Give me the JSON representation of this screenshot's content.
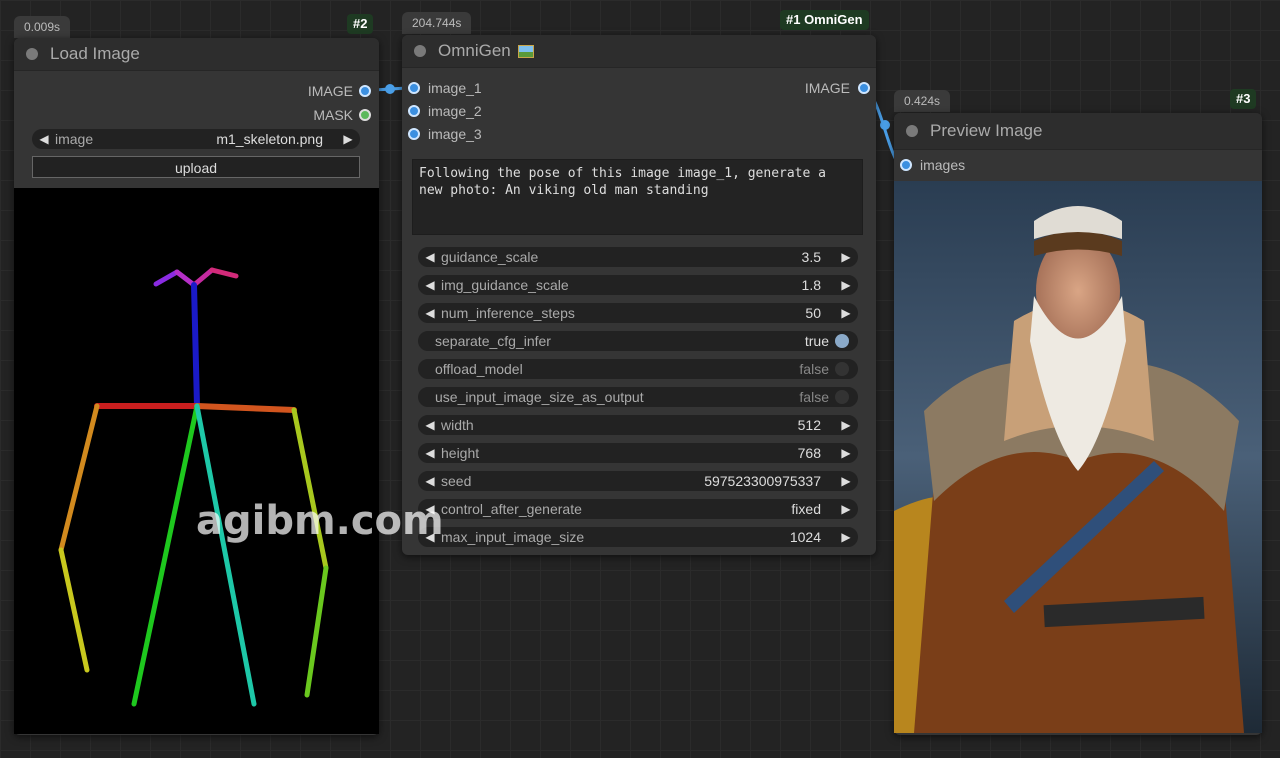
{
  "load_image": {
    "time": "0.009s",
    "id": "#2",
    "title": "Load Image",
    "outputs": [
      "IMAGE",
      "MASK"
    ],
    "image_widget_label": "image",
    "image_widget_value": "m1_skeleton.png",
    "upload_label": "upload"
  },
  "omnigen": {
    "time": "204.744s",
    "id": "#1 OmniGen",
    "title": "OmniGen",
    "title_icon": "picture-icon",
    "inputs": [
      "image_1",
      "image_2",
      "image_3"
    ],
    "output": "IMAGE",
    "prompt": "Following the pose of this image image_1, generate a\nnew photo: An viking old man standing",
    "widgets": [
      {
        "label": "guidance_scale",
        "value": "3.5",
        "type": "number"
      },
      {
        "label": "img_guidance_scale",
        "value": "1.8",
        "type": "number"
      },
      {
        "label": "num_inference_steps",
        "value": "50",
        "type": "number"
      },
      {
        "label": "separate_cfg_infer",
        "value": "true",
        "type": "toggle",
        "on": true
      },
      {
        "label": "offload_model",
        "value": "false",
        "type": "toggle",
        "on": false
      },
      {
        "label": "use_input_image_size_as_output",
        "value": "false",
        "type": "toggle",
        "on": false
      },
      {
        "label": "width",
        "value": "512",
        "type": "number"
      },
      {
        "label": "height",
        "value": "768",
        "type": "number"
      },
      {
        "label": "seed",
        "value": "597523300975337",
        "type": "number"
      },
      {
        "label": "control_after_generate",
        "value": "fixed",
        "type": "combo"
      },
      {
        "label": "max_input_image_size",
        "value": "1024",
        "type": "number"
      }
    ]
  },
  "preview": {
    "time": "0.424s",
    "id": "#3",
    "title": "Preview Image",
    "input": "images"
  },
  "watermark": "agibm.com",
  "colors": {
    "link_blue": "#4a9fe8",
    "badge_green": "#1e3a22"
  }
}
